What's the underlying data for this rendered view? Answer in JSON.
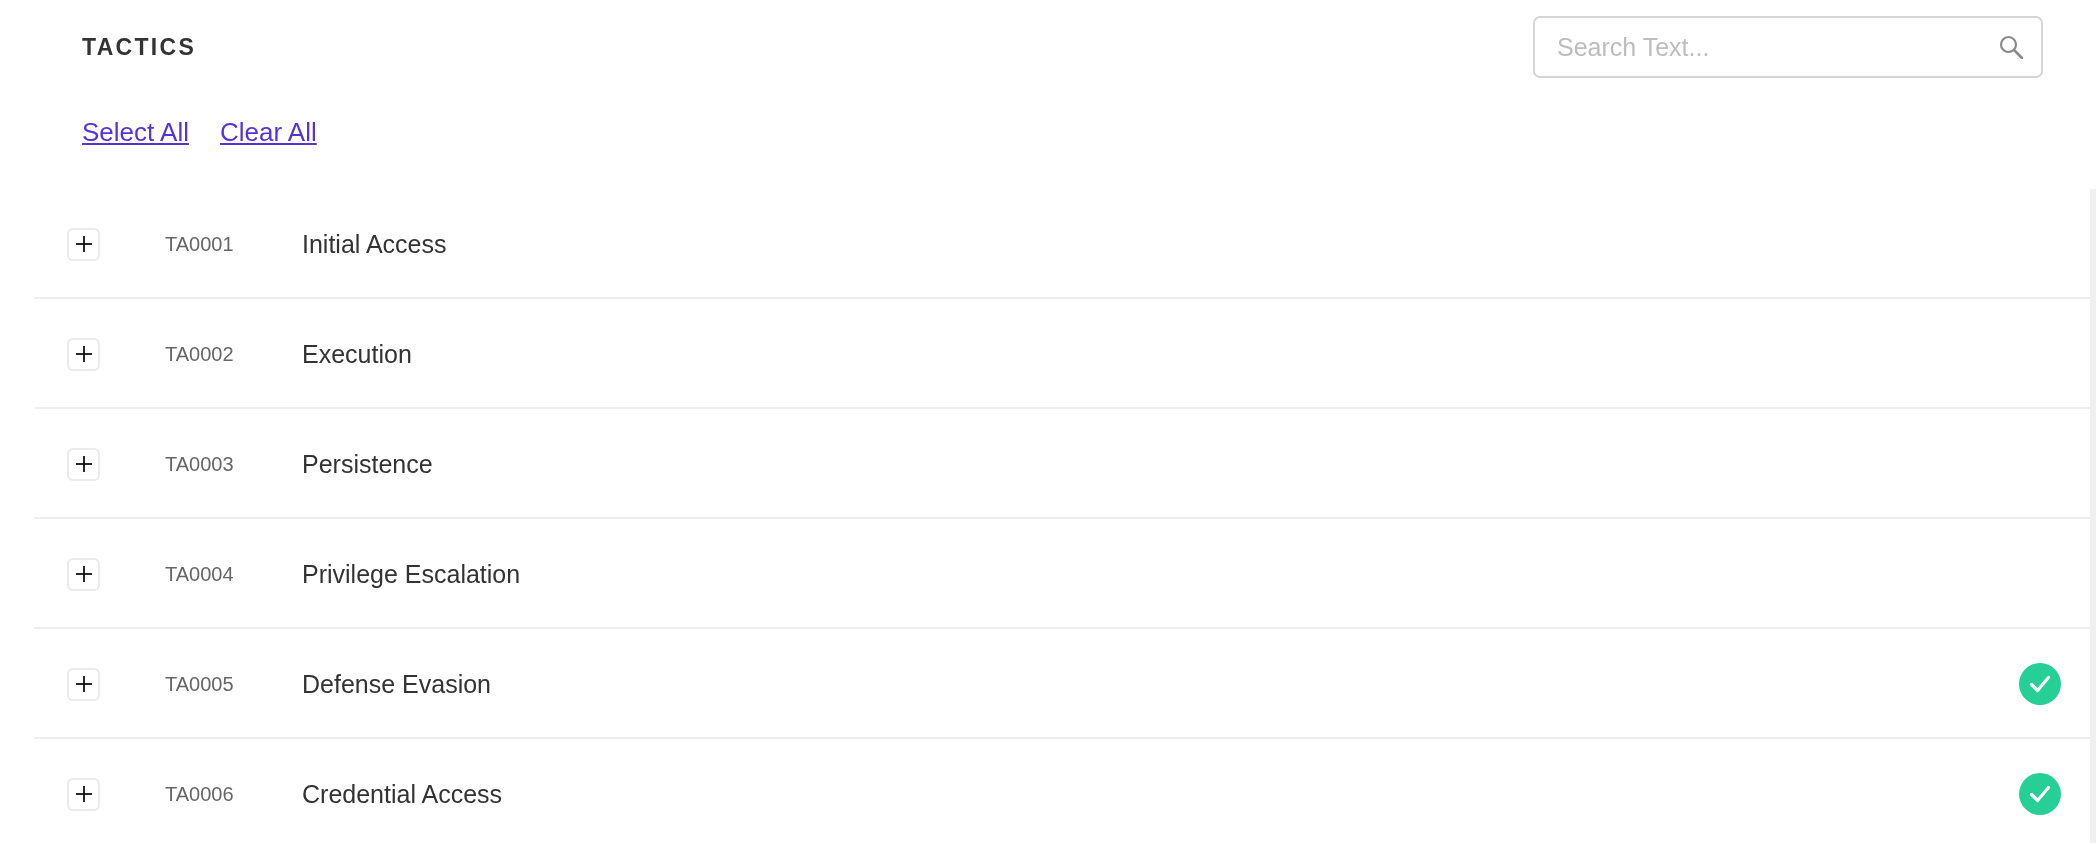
{
  "header": {
    "title": "TACTICS"
  },
  "search": {
    "placeholder": "Search Text..."
  },
  "actions": [
    {
      "label": "Select All"
    },
    {
      "label": "Clear All"
    }
  ],
  "tactics": [
    {
      "id": "TA0001",
      "name": "Initial Access",
      "expanded": false,
      "selected": false
    },
    {
      "id": "TA0002",
      "name": "Execution",
      "expanded": false,
      "selected": false
    },
    {
      "id": "TA0003",
      "name": "Persistence",
      "expanded": false,
      "selected": false
    },
    {
      "id": "TA0004",
      "name": "Privilege Escalation",
      "expanded": false,
      "selected": false
    },
    {
      "id": "TA0005",
      "name": "Defense Evasion",
      "expanded": false,
      "selected": true
    },
    {
      "id": "TA0006",
      "name": "Credential Access",
      "expanded": false,
      "selected": true
    }
  ]
}
